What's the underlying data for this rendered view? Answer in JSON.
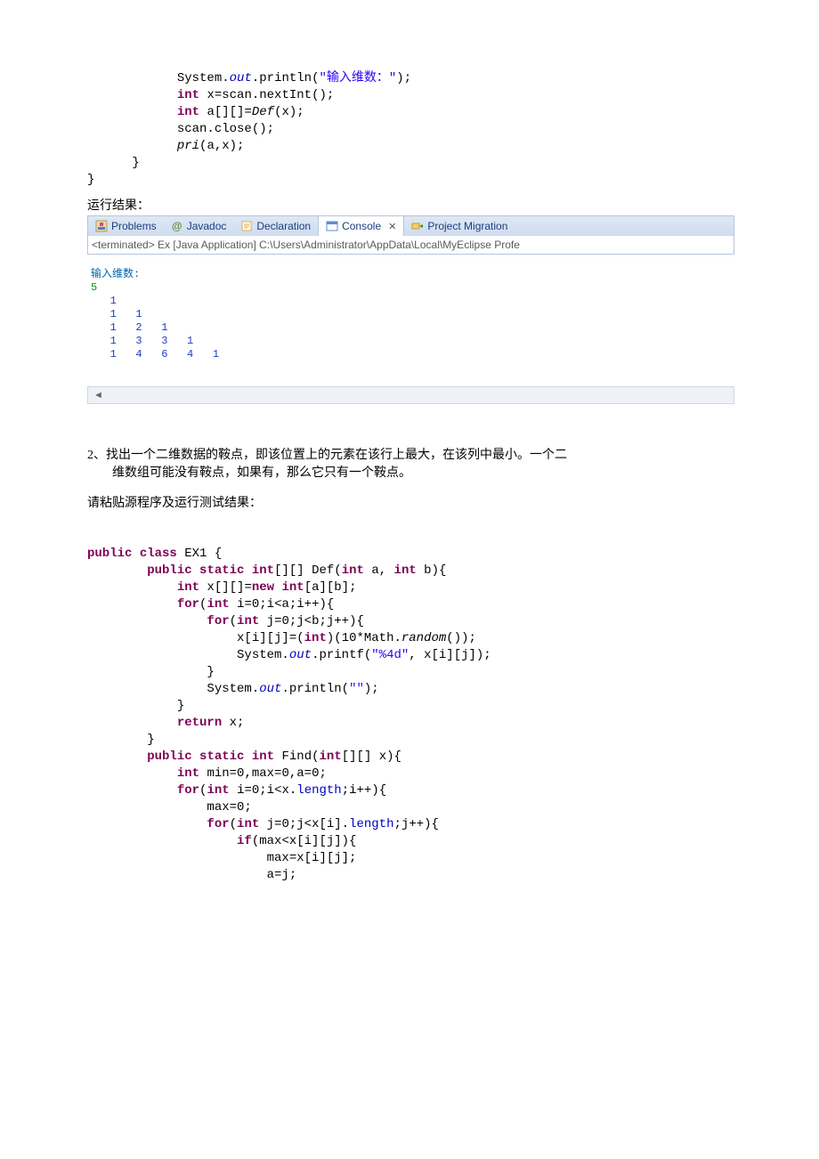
{
  "code1": {
    "l1a": "            System.",
    "l1b": "out",
    "l1c": ".println(",
    "l1d": "\"输入维数：\"",
    "l1e": ");",
    "l2a": "            ",
    "l2b": "int",
    "l2c": " x=scan.nextInt();",
    "l3a": "            ",
    "l3b": "int",
    "l3c": " a[][]=",
    "l3d": "Def",
    "l3e": "(x);",
    "l4": "            scan.close();",
    "l5a": "            ",
    "l5b": "pri",
    "l5c": "(a,x);",
    "l6": "      }",
    "l7": "}"
  },
  "runLabel": "运行结果：",
  "tabs": {
    "problems": "Problems",
    "javadoc": "Javadoc",
    "declaration": "Declaration",
    "console": "Console",
    "migration": "Project Migration"
  },
  "terminated": "<terminated> Ex [Java Application] C:\\Users\\Administrator\\AppData\\Local\\MyEclipse Profe",
  "console": {
    "prompt": "输入维数:",
    "input": "5",
    "r1": "   1",
    "r2": "   1   1",
    "r3": "   1   2   1",
    "r4": "   1   3   3   1",
    "r5": "   1   4   6   4   1"
  },
  "scrollArrow": "◄",
  "q2": {
    "num": "2、",
    "line1": "找出一个二维数据的鞍点，即该位置上的元素在该行上最大，在该列中最小。一个二",
    "line2": "维数组可能没有鞍点，如果有，那么它只有一个鞍点。"
  },
  "instr": "请粘贴源程序及运行测试结果：",
  "code2": {
    "l01a": "public",
    "l01b": " ",
    "l01c": "class",
    "l01d": " EX1 {",
    "l02a": "        ",
    "l02b": "public",
    "l02c": " ",
    "l02d": "static",
    "l02e": " ",
    "l02f": "int",
    "l02g": "[][] Def(",
    "l02h": "int",
    "l02i": " a, ",
    "l02j": "int",
    "l02k": " b){",
    "l03a": "            ",
    "l03b": "int",
    "l03c": " x[][]=",
    "l03d": "new",
    "l03e": " ",
    "l03f": "int",
    "l03g": "[a][b];",
    "l04a": "            ",
    "l04b": "for",
    "l04c": "(",
    "l04d": "int",
    "l04e": " i=0;i<a;i++){",
    "l05a": "                ",
    "l05b": "for",
    "l05c": "(",
    "l05d": "int",
    "l05e": " j=0;j<b;j++){",
    "l06a": "                    x[i][j]=(",
    "l06b": "int",
    "l06c": ")(10*Math.",
    "l06d": "random",
    "l06e": "());",
    "l07a": "                    System.",
    "l07b": "out",
    "l07c": ".printf(",
    "l07d": "\"%4d\"",
    "l07e": ", x[i][j]);",
    "l08": "                }",
    "l09a": "                System.",
    "l09b": "out",
    "l09c": ".println(",
    "l09d": "\"\"",
    "l09e": ");",
    "l10": "            }",
    "l11a": "            ",
    "l11b": "return",
    "l11c": " x;",
    "l12": "        }",
    "l13a": "        ",
    "l13b": "public",
    "l13c": " ",
    "l13d": "static",
    "l13e": " ",
    "l13f": "int",
    "l13g": " Find(",
    "l13h": "int",
    "l13i": "[][] x){",
    "l14a": "            ",
    "l14b": "int",
    "l14c": " min=0,max=0,a=0;",
    "l15a": "            ",
    "l15b": "for",
    "l15c": "(",
    "l15d": "int",
    "l15e": " i=0;i<x.",
    "l15f": "length",
    "l15g": ";i++){",
    "l16": "                max=0;",
    "l17a": "                ",
    "l17b": "for",
    "l17c": "(",
    "l17d": "int",
    "l17e": " j=0;j<x[i].",
    "l17f": "length",
    "l17g": ";j++){",
    "l18a": "                    ",
    "l18b": "if",
    "l18c": "(max<x[i][j]){",
    "l19": "                        max=x[i][j];",
    "l20": "                        a=j;"
  }
}
